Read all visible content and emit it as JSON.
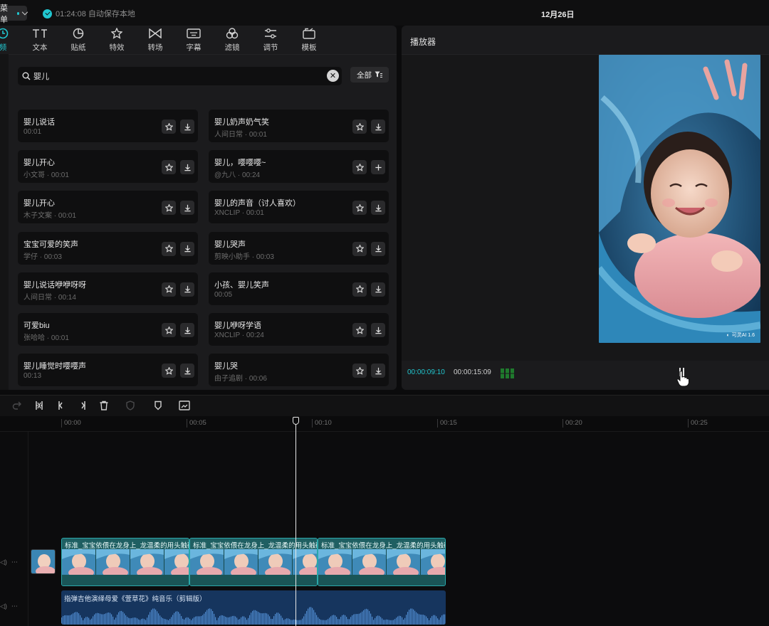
{
  "topbar": {
    "menu_label": "菜单",
    "autosave_text": "01:24:08 自动保存本地",
    "date_title": "12月26日"
  },
  "toolbar": {
    "items": [
      {
        "label": "频",
        "icon": "media-icon"
      },
      {
        "label": "文本",
        "icon": "text-icon"
      },
      {
        "label": "贴纸",
        "icon": "sticker-icon"
      },
      {
        "label": "特效",
        "icon": "effects-icon"
      },
      {
        "label": "转场",
        "icon": "transition-icon"
      },
      {
        "label": "字幕",
        "icon": "subtitle-icon"
      },
      {
        "label": "滤镜",
        "icon": "filter-icon"
      },
      {
        "label": "调节",
        "icon": "adjust-icon"
      },
      {
        "label": "模板",
        "icon": "template-icon"
      }
    ]
  },
  "search": {
    "value": "婴儿",
    "filter_label": "全部"
  },
  "sounds": {
    "left": [
      {
        "name": "婴儿说话",
        "meta": "00:01"
      },
      {
        "name": "婴儿开心",
        "meta": "小文哥 · 00:01"
      },
      {
        "name": "婴儿开心",
        "meta": "木子文案 · 00:01"
      },
      {
        "name": "宝宝可爱的笑声",
        "meta": "学仔 · 00:03"
      },
      {
        "name": "婴儿说话咿咿呀呀",
        "meta": "人间日常 · 00:14"
      },
      {
        "name": "可爱biu",
        "meta": "张哈哈 · 00:01"
      },
      {
        "name": "婴儿睡觉时嘤嘤声",
        "meta": "00:13"
      }
    ],
    "right": [
      {
        "name": "婴儿奶声奶气笑",
        "meta": "人间日常 · 00:01"
      },
      {
        "name": "婴儿，嘤嘤嘤~",
        "meta": "@九八 · 00:24"
      },
      {
        "name": "婴儿的声音（讨人喜欢）",
        "meta": "XNCLIP · 00:01"
      },
      {
        "name": "婴儿哭声",
        "meta": "剪映小助手 · 00:03"
      },
      {
        "name": "小孩、婴儿笑声",
        "meta": "00:05"
      },
      {
        "name": "婴儿咿呀学语",
        "meta": "XNCLIP · 00:24"
      },
      {
        "name": "婴儿哭",
        "meta": "由子追剧 · 00:06"
      }
    ]
  },
  "player": {
    "title": "播放器",
    "current_time": "00:00:09:10",
    "total_time": "00:00:15:09",
    "watermark": "可灵AI 1.6"
  },
  "timeline": {
    "ruler_labels": [
      "00:00",
      "00:05",
      "00:10",
      "00:15",
      "00:20",
      "00:25"
    ],
    "video_clip_title": "标准_宝宝依偎在龙身上_龙温柔的用头触碰",
    "audio_clip_title": "指弹吉他演绎母爱《萱草花》纯音乐（剪辑版）"
  },
  "colors": {
    "accent": "#21c7d0",
    "video_clip": "#1f5f62",
    "audio_clip": "#16355e"
  }
}
